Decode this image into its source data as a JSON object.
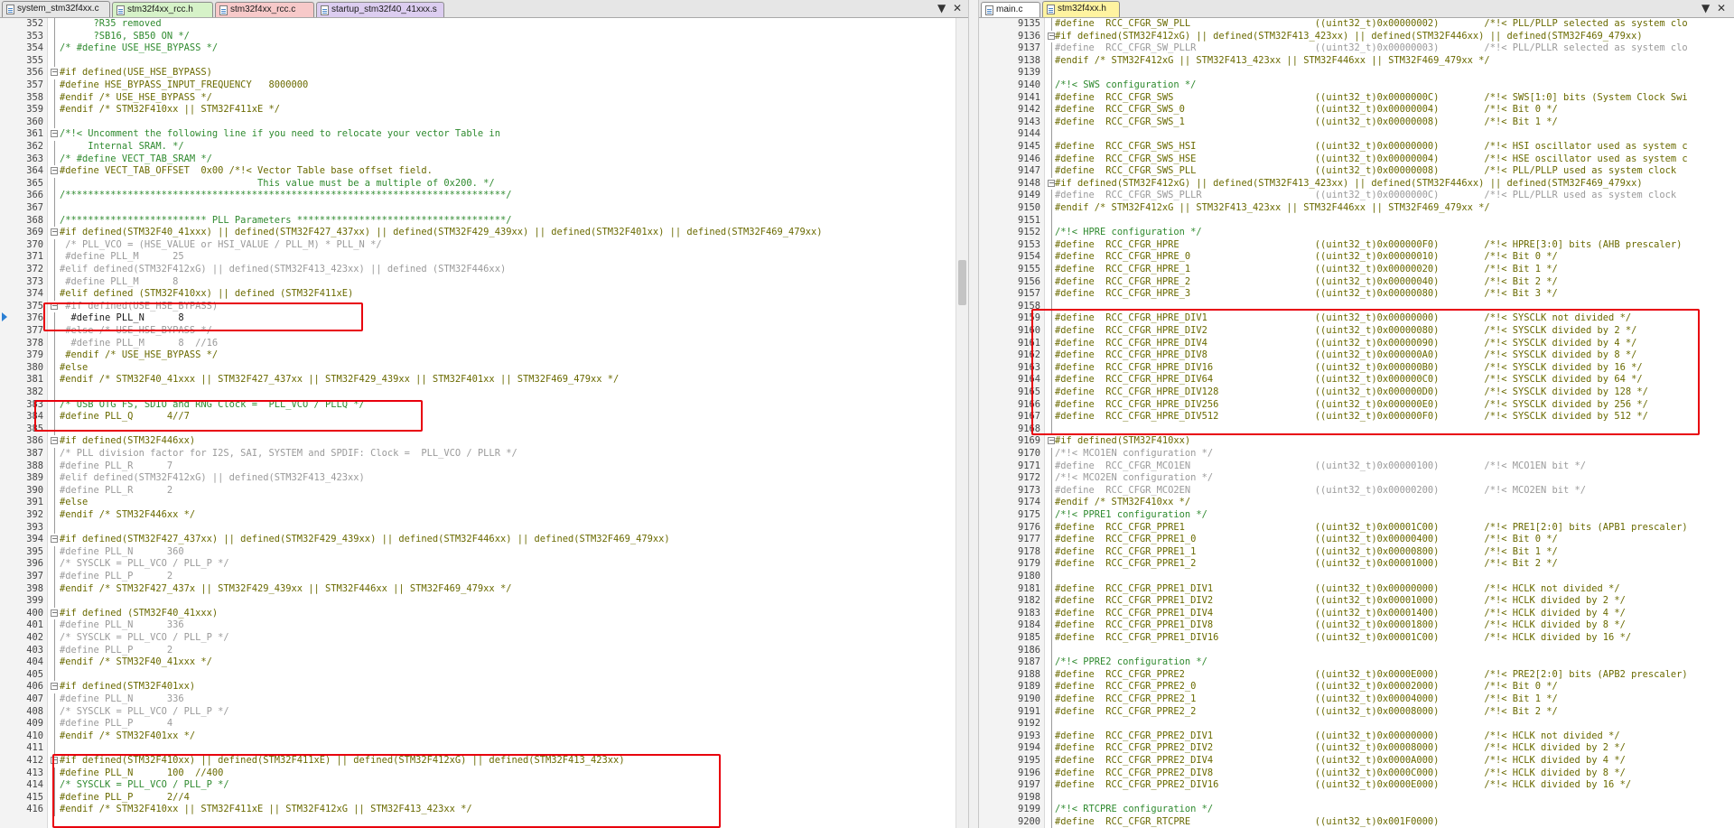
{
  "left_pane": {
    "tabs": [
      {
        "label": "system_stm32f4xx.c",
        "color": "#ffffff",
        "active": true
      },
      {
        "label": "stm32f4xx_rcc.h",
        "color": "#d6f2c8",
        "active": false
      },
      {
        "label": "stm32f4xx_rcc.c",
        "color": "#f7c9c9",
        "active": false
      },
      {
        "label": "startup_stm32f40_41xxx.s",
        "color": "#dccdf0",
        "active": false
      }
    ],
    "tab_menu_glyph": "▼",
    "tab_close_glyph": "✕",
    "lines": [
      {
        "n": "352",
        "t": "      ?R35 removed",
        "c": "c-cmt"
      },
      {
        "n": "353",
        "t": "      ?SB16, SB50 ON */",
        "c": "c-cmt"
      },
      {
        "n": "354",
        "t": "/* #define USE_HSE_BYPASS */",
        "c": "c-cmt"
      },
      {
        "n": "355",
        "t": "",
        "c": ""
      },
      {
        "n": "356",
        "t": "#if defined(USE_HSE_BYPASS)",
        "c": "c-pp",
        "fold": "-"
      },
      {
        "n": "357",
        "t": "#define HSE_BYPASS_INPUT_FREQUENCY   8000000",
        "c": "c-pp"
      },
      {
        "n": "358",
        "t": "#endif /* USE_HSE_BYPASS */",
        "c": "c-pp"
      },
      {
        "n": "359",
        "t": "#endif /* STM32F410xx || STM32F411xE */",
        "c": "c-pp"
      },
      {
        "n": "360",
        "t": "",
        "c": ""
      },
      {
        "n": "361",
        "t": "/*!< Uncomment the following line if you need to relocate your vector Table in",
        "c": "c-cmt",
        "fold": "-"
      },
      {
        "n": "362",
        "t": "     Internal SRAM. */",
        "c": "c-cmt"
      },
      {
        "n": "363",
        "t": "/* #define VECT_TAB_SRAM */",
        "c": "c-cmt"
      },
      {
        "n": "364",
        "t": "#define VECT_TAB_OFFSET  0x00 /*!< Vector Table base offset field.",
        "c": "c-pp",
        "fold": "-"
      },
      {
        "n": "365",
        "t": "                                   This value must be a multiple of 0x200. */",
        "c": "c-cmt"
      },
      {
        "n": "366",
        "t": "/******************************************************************************/",
        "c": "c-cmt"
      },
      {
        "n": "367",
        "t": "",
        "c": ""
      },
      {
        "n": "368",
        "t": "/************************* PLL Parameters *************************************/",
        "c": "c-cmt"
      },
      {
        "n": "369",
        "t": "#if defined(STM32F40_41xxx) || defined(STM32F427_437xx) || defined(STM32F429_439xx) || defined(STM32F401xx) || defined(STM32F469_479xx)",
        "c": "c-pp",
        "fold": "-"
      },
      {
        "n": "370",
        "t": " /* PLL_VCO = (HSE_VALUE or HSI_VALUE / PLL_M) * PLL_N */",
        "c": "c-gray"
      },
      {
        "n": "371",
        "t": " #define PLL_M      25",
        "c": "c-gray"
      },
      {
        "n": "372",
        "t": "#elif defined(STM32F412xG) || defined(STM32F413_423xx) || defined (STM32F446xx)",
        "c": "c-gray"
      },
      {
        "n": "373",
        "t": " #define PLL_M      8",
        "c": "c-gray"
      },
      {
        "n": "374",
        "t": "#elif defined (STM32F410xx) || defined (STM32F411xE)",
        "c": "c-pp"
      },
      {
        "n": "375",
        "t": " #if defined(USE_HSE_BYPASS)",
        "c": "c-gray",
        "fold": "-"
      },
      {
        "n": "376",
        "t": "  #define PLL_N      8",
        "c": ""
      },
      {
        "n": "377",
        "t": " #else /* USE_HSE_BYPASS */",
        "c": "c-gray"
      },
      {
        "n": "378",
        "t": "  #define PLL_M      8  //16",
        "c": "c-gray"
      },
      {
        "n": "379",
        "t": " #endif /* USE_HSE_BYPASS */",
        "c": "c-pp"
      },
      {
        "n": "380",
        "t": "#else",
        "c": "c-pp"
      },
      {
        "n": "381",
        "t": "#endif /* STM32F40_41xxx || STM32F427_437xx || STM32F429_439xx || STM32F401xx || STM32F469_479xx */",
        "c": "c-pp"
      },
      {
        "n": "382",
        "t": "",
        "c": ""
      },
      {
        "n": "383",
        "t": "/* USB OTG FS, SDIO and RNG Clock =  PLL_VCO / PLLQ */",
        "c": "c-cmt"
      },
      {
        "n": "384",
        "t": "#define PLL_Q      4//7",
        "c": "c-pp"
      },
      {
        "n": "385",
        "t": "",
        "c": ""
      },
      {
        "n": "386",
        "t": "#if defined(STM32F446xx)",
        "c": "c-pp",
        "fold": "-"
      },
      {
        "n": "387",
        "t": "/* PLL division factor for I2S, SAI, SYSTEM and SPDIF: Clock =  PLL_VCO / PLLR */",
        "c": "c-gray"
      },
      {
        "n": "388",
        "t": "#define PLL_R      7",
        "c": "c-gray"
      },
      {
        "n": "389",
        "t": "#elif defined(STM32F412xG) || defined(STM32F413_423xx)",
        "c": "c-gray"
      },
      {
        "n": "390",
        "t": "#define PLL_R      2",
        "c": "c-gray"
      },
      {
        "n": "391",
        "t": "#else",
        "c": "c-pp"
      },
      {
        "n": "392",
        "t": "#endif /* STM32F446xx */",
        "c": "c-pp"
      },
      {
        "n": "393",
        "t": "",
        "c": ""
      },
      {
        "n": "394",
        "t": "#if defined(STM32F427_437xx) || defined(STM32F429_439xx) || defined(STM32F446xx) || defined(STM32F469_479xx)",
        "c": "c-pp",
        "fold": "-"
      },
      {
        "n": "395",
        "t": "#define PLL_N      360",
        "c": "c-gray"
      },
      {
        "n": "396",
        "t": "/* SYSCLK = PLL_VCO / PLL_P */",
        "c": "c-gray"
      },
      {
        "n": "397",
        "t": "#define PLL_P      2",
        "c": "c-gray"
      },
      {
        "n": "398",
        "t": "#endif /* STM32F427_437x || STM32F429_439xx || STM32F446xx || STM32F469_479xx */",
        "c": "c-pp"
      },
      {
        "n": "399",
        "t": "",
        "c": ""
      },
      {
        "n": "400",
        "t": "#if defined (STM32F40_41xxx)",
        "c": "c-pp",
        "fold": "-"
      },
      {
        "n": "401",
        "t": "#define PLL_N      336",
        "c": "c-gray"
      },
      {
        "n": "402",
        "t": "/* SYSCLK = PLL_VCO / PLL_P */",
        "c": "c-gray"
      },
      {
        "n": "403",
        "t": "#define PLL_P      2",
        "c": "c-gray"
      },
      {
        "n": "404",
        "t": "#endif /* STM32F40_41xxx */",
        "c": "c-pp"
      },
      {
        "n": "405",
        "t": "",
        "c": ""
      },
      {
        "n": "406",
        "t": "#if defined(STM32F401xx)",
        "c": "c-pp",
        "fold": "-"
      },
      {
        "n": "407",
        "t": "#define PLL_N      336",
        "c": "c-gray"
      },
      {
        "n": "408",
        "t": "/* SYSCLK = PLL_VCO / PLL_P */",
        "c": "c-gray"
      },
      {
        "n": "409",
        "t": "#define PLL_P      4",
        "c": "c-gray"
      },
      {
        "n": "410",
        "t": "#endif /* STM32F401xx */",
        "c": "c-pp"
      },
      {
        "n": "411",
        "t": "",
        "c": ""
      },
      {
        "n": "412",
        "t": "#if defined(STM32F410xx) || defined(STM32F411xE) || defined(STM32F412xG) || defined(STM32F413_423xx)",
        "c": "c-pp",
        "fold": "-"
      },
      {
        "n": "413",
        "t": "#define PLL_N      100  //400",
        "c": "c-pp"
      },
      {
        "n": "414",
        "t": "/* SYSCLK = PLL_VCO / PLL_P */",
        "c": "c-cmt"
      },
      {
        "n": "415",
        "t": "#define PLL_P      2//4",
        "c": "c-pp"
      },
      {
        "n": "416",
        "t": "#endif /* STM32F410xx || STM32F411xE || STM32F412xG || STM32F413_423xx */",
        "c": "c-pp"
      }
    ]
  },
  "right_pane": {
    "tabs": [
      {
        "label": "main.c",
        "color": "#ffffff",
        "active": false
      },
      {
        "label": "stm32f4xx.h",
        "color": "#fff3a0",
        "active": true
      }
    ],
    "tab_menu_glyph": "▼",
    "tab_close_glyph": "✕",
    "lines": [
      {
        "n": "9135",
        "t": "#define  RCC_CFGR_SW_PLL                      ((uint32_t)0x00000002)        /*!< PLL/PLLP selected as system clo",
        "c": "c-pp"
      },
      {
        "n": "9136",
        "t": "#if defined(STM32F412xG) || defined(STM32F413_423xx) || defined(STM32F446xx) || defined(STM32F469_479xx)",
        "c": "c-pp",
        "fold": "-"
      },
      {
        "n": "9137",
        "t": "#define  RCC_CFGR_SW_PLLR                     ((uint32_t)0x00000003)        /*!< PLL/PLLR selected as system clo",
        "c": "c-gray"
      },
      {
        "n": "9138",
        "t": "#endif /* STM32F412xG || STM32F413_423xx || STM32F446xx || STM32F469_479xx */",
        "c": "c-pp"
      },
      {
        "n": "9139",
        "t": "",
        "c": ""
      },
      {
        "n": "9140",
        "t": "/*!< SWS configuration */",
        "c": "c-cmt"
      },
      {
        "n": "9141",
        "t": "#define  RCC_CFGR_SWS                         ((uint32_t)0x0000000C)        /*!< SWS[1:0] bits (System Clock Swi",
        "c": "c-pp"
      },
      {
        "n": "9142",
        "t": "#define  RCC_CFGR_SWS_0                       ((uint32_t)0x00000004)        /*!< Bit 0 */",
        "c": "c-pp"
      },
      {
        "n": "9143",
        "t": "#define  RCC_CFGR_SWS_1                       ((uint32_t)0x00000008)        /*!< Bit 1 */",
        "c": "c-pp"
      },
      {
        "n": "9144",
        "t": "",
        "c": ""
      },
      {
        "n": "9145",
        "t": "#define  RCC_CFGR_SWS_HSI                     ((uint32_t)0x00000000)        /*!< HSI oscillator used as system c",
        "c": "c-pp"
      },
      {
        "n": "9146",
        "t": "#define  RCC_CFGR_SWS_HSE                     ((uint32_t)0x00000004)        /*!< HSE oscillator used as system c",
        "c": "c-pp"
      },
      {
        "n": "9147",
        "t": "#define  RCC_CFGR_SWS_PLL                     ((uint32_t)0x00000008)        /*!< PLL/PLLP used as system clock",
        "c": "c-pp"
      },
      {
        "n": "9148",
        "t": "#if defined(STM32F412xG) || defined(STM32F413_423xx) || defined(STM32F446xx) || defined(STM32F469_479xx)",
        "c": "c-pp",
        "fold": "-"
      },
      {
        "n": "9149",
        "t": "#define  RCC_CFGR_SWS_PLLR                    ((uint32_t)0x0000000C)        /*!< PLL/PLLR used as system clock",
        "c": "c-gray"
      },
      {
        "n": "9150",
        "t": "#endif /* STM32F412xG || STM32F413_423xx || STM32F446xx || STM32F469_479xx */",
        "c": "c-pp"
      },
      {
        "n": "9151",
        "t": "",
        "c": ""
      },
      {
        "n": "9152",
        "t": "/*!< HPRE configuration */",
        "c": "c-cmt"
      },
      {
        "n": "9153",
        "t": "#define  RCC_CFGR_HPRE                        ((uint32_t)0x000000F0)        /*!< HPRE[3:0] bits (AHB prescaler)",
        "c": "c-pp"
      },
      {
        "n": "9154",
        "t": "#define  RCC_CFGR_HPRE_0                      ((uint32_t)0x00000010)        /*!< Bit 0 */",
        "c": "c-pp"
      },
      {
        "n": "9155",
        "t": "#define  RCC_CFGR_HPRE_1                      ((uint32_t)0x00000020)        /*!< Bit 1 */",
        "c": "c-pp"
      },
      {
        "n": "9156",
        "t": "#define  RCC_CFGR_HPRE_2                      ((uint32_t)0x00000040)        /*!< Bit 2 */",
        "c": "c-pp"
      },
      {
        "n": "9157",
        "t": "#define  RCC_CFGR_HPRE_3                      ((uint32_t)0x00000080)        /*!< Bit 3 */",
        "c": "c-pp"
      },
      {
        "n": "9158",
        "t": "",
        "c": ""
      },
      {
        "n": "9159",
        "t": "#define  RCC_CFGR_HPRE_DIV1                   ((uint32_t)0x00000000)        /*!< SYSCLK not divided */",
        "c": "c-pp"
      },
      {
        "n": "9160",
        "t": "#define  RCC_CFGR_HPRE_DIV2                   ((uint32_t)0x00000080)        /*!< SYSCLK divided by 2 */",
        "c": "c-pp"
      },
      {
        "n": "9161",
        "t": "#define  RCC_CFGR_HPRE_DIV4                   ((uint32_t)0x00000090)        /*!< SYSCLK divided by 4 */",
        "c": "c-pp"
      },
      {
        "n": "9162",
        "t": "#define  RCC_CFGR_HPRE_DIV8                   ((uint32_t)0x000000A0)        /*!< SYSCLK divided by 8 */",
        "c": "c-pp"
      },
      {
        "n": "9163",
        "t": "#define  RCC_CFGR_HPRE_DIV16                  ((uint32_t)0x000000B0)        /*!< SYSCLK divided by 16 */",
        "c": "c-pp"
      },
      {
        "n": "9164",
        "t": "#define  RCC_CFGR_HPRE_DIV64                  ((uint32_t)0x000000C0)        /*!< SYSCLK divided by 64 */",
        "c": "c-pp"
      },
      {
        "n": "9165",
        "t": "#define  RCC_CFGR_HPRE_DIV128                 ((uint32_t)0x000000D0)        /*!< SYSCLK divided by 128 */",
        "c": "c-pp"
      },
      {
        "n": "9166",
        "t": "#define  RCC_CFGR_HPRE_DIV256                 ((uint32_t)0x000000E0)        /*!< SYSCLK divided by 256 */",
        "c": "c-pp"
      },
      {
        "n": "9167",
        "t": "#define  RCC_CFGR_HPRE_DIV512                 ((uint32_t)0x000000F0)        /*!< SYSCLK divided by 512 */",
        "c": "c-pp"
      },
      {
        "n": "9168",
        "t": "",
        "c": ""
      },
      {
        "n": "9169",
        "t": "#if defined(STM32F410xx)",
        "c": "c-pp",
        "fold": "-"
      },
      {
        "n": "9170",
        "t": "/*!< MCO1EN configuration */",
        "c": "c-gray"
      },
      {
        "n": "9171",
        "t": "#define  RCC_CFGR_MCO1EN                      ((uint32_t)0x00000100)        /*!< MCO1EN bit */",
        "c": "c-gray"
      },
      {
        "n": "9172",
        "t": "/*!< MCO2EN configuration */",
        "c": "c-gray"
      },
      {
        "n": "9173",
        "t": "#define  RCC_CFGR_MCO2EN                      ((uint32_t)0x00000200)        /*!< MCO2EN bit */",
        "c": "c-gray"
      },
      {
        "n": "9174",
        "t": "#endif /* STM32F410xx */",
        "c": "c-pp"
      },
      {
        "n": "9175",
        "t": "/*!< PPRE1 configuration */",
        "c": "c-cmt"
      },
      {
        "n": "9176",
        "t": "#define  RCC_CFGR_PPRE1                       ((uint32_t)0x00001C00)        /*!< PRE1[2:0] bits (APB1 prescaler)",
        "c": "c-pp"
      },
      {
        "n": "9177",
        "t": "#define  RCC_CFGR_PPRE1_0                     ((uint32_t)0x00000400)        /*!< Bit 0 */",
        "c": "c-pp"
      },
      {
        "n": "9178",
        "t": "#define  RCC_CFGR_PPRE1_1                     ((uint32_t)0x00000800)        /*!< Bit 1 */",
        "c": "c-pp"
      },
      {
        "n": "9179",
        "t": "#define  RCC_CFGR_PPRE1_2                     ((uint32_t)0x00001000)        /*!< Bit 2 */",
        "c": "c-pp"
      },
      {
        "n": "9180",
        "t": "",
        "c": ""
      },
      {
        "n": "9181",
        "t": "#define  RCC_CFGR_PPRE1_DIV1                  ((uint32_t)0x00000000)        /*!< HCLK not divided */",
        "c": "c-pp"
      },
      {
        "n": "9182",
        "t": "#define  RCC_CFGR_PPRE1_DIV2                  ((uint32_t)0x00001000)        /*!< HCLK divided by 2 */",
        "c": "c-pp"
      },
      {
        "n": "9183",
        "t": "#define  RCC_CFGR_PPRE1_DIV4                  ((uint32_t)0x00001400)        /*!< HCLK divided by 4 */",
        "c": "c-pp"
      },
      {
        "n": "9184",
        "t": "#define  RCC_CFGR_PPRE1_DIV8                  ((uint32_t)0x00001800)        /*!< HCLK divided by 8 */",
        "c": "c-pp"
      },
      {
        "n": "9185",
        "t": "#define  RCC_CFGR_PPRE1_DIV16                 ((uint32_t)0x00001C00)        /*!< HCLK divided by 16 */",
        "c": "c-pp"
      },
      {
        "n": "9186",
        "t": "",
        "c": ""
      },
      {
        "n": "9187",
        "t": "/*!< PPRE2 configuration */",
        "c": "c-cmt"
      },
      {
        "n": "9188",
        "t": "#define  RCC_CFGR_PPRE2                       ((uint32_t)0x0000E000)        /*!< PRE2[2:0] bits (APB2 prescaler)",
        "c": "c-pp"
      },
      {
        "n": "9189",
        "t": "#define  RCC_CFGR_PPRE2_0                     ((uint32_t)0x00002000)        /*!< Bit 0 */",
        "c": "c-pp"
      },
      {
        "n": "9190",
        "t": "#define  RCC_CFGR_PPRE2_1                     ((uint32_t)0x00004000)        /*!< Bit 1 */",
        "c": "c-pp"
      },
      {
        "n": "9191",
        "t": "#define  RCC_CFGR_PPRE2_2                     ((uint32_t)0x00008000)        /*!< Bit 2 */",
        "c": "c-pp"
      },
      {
        "n": "9192",
        "t": "",
        "c": ""
      },
      {
        "n": "9193",
        "t": "#define  RCC_CFGR_PPRE2_DIV1                  ((uint32_t)0x00000000)        /*!< HCLK not divided */",
        "c": "c-pp"
      },
      {
        "n": "9194",
        "t": "#define  RCC_CFGR_PPRE2_DIV2                  ((uint32_t)0x00008000)        /*!< HCLK divided by 2 */",
        "c": "c-pp"
      },
      {
        "n": "9195",
        "t": "#define  RCC_CFGR_PPRE2_DIV4                  ((uint32_t)0x0000A000)        /*!< HCLK divided by 4 */",
        "c": "c-pp"
      },
      {
        "n": "9196",
        "t": "#define  RCC_CFGR_PPRE2_DIV8                  ((uint32_t)0x0000C000)        /*!< HCLK divided by 8 */",
        "c": "c-pp"
      },
      {
        "n": "9197",
        "t": "#define  RCC_CFGR_PPRE2_DIV16                 ((uint32_t)0x0000E000)        /*!< HCLK divided by 16 */",
        "c": "c-pp"
      },
      {
        "n": "9198",
        "t": "",
        "c": ""
      },
      {
        "n": "9199",
        "t": "/*!< RTCPRE configuration */",
        "c": "c-cmt"
      },
      {
        "n": "9200",
        "t": "#define  RCC_CFGR_RTCPRE                      ((uint32_t)0x001F0000)",
        "c": "c-pp"
      }
    ]
  },
  "highlight_color": "#e8000d"
}
